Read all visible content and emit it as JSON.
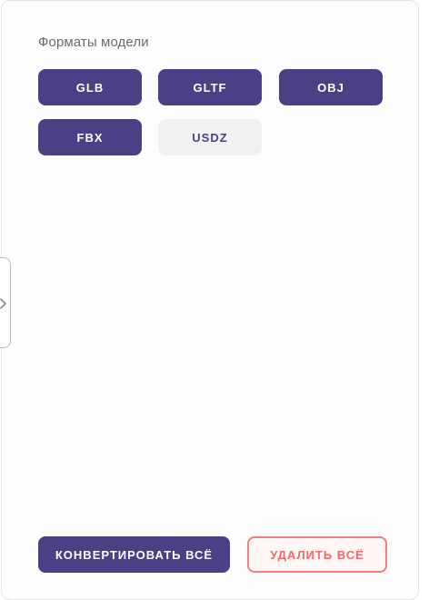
{
  "formats_panel": {
    "title": "Форматы модели",
    "formats": [
      {
        "label": "GLB",
        "selected": true
      },
      {
        "label": "GLTF",
        "selected": true
      },
      {
        "label": "OBJ",
        "selected": true
      },
      {
        "label": "FBX",
        "selected": true
      },
      {
        "label": "USDZ",
        "selected": false
      }
    ]
  },
  "side_tab": {
    "icon": "chevron-right-icon"
  },
  "actions": {
    "convert_all": "КОНВЕРТИРОВАТЬ ВСЁ",
    "delete_all": "УДАЛИТЬ ВСЁ"
  },
  "colors": {
    "accent": "#4b3f86",
    "danger": "#ee6a6a",
    "inactive_bg": "#f1f1f1"
  }
}
